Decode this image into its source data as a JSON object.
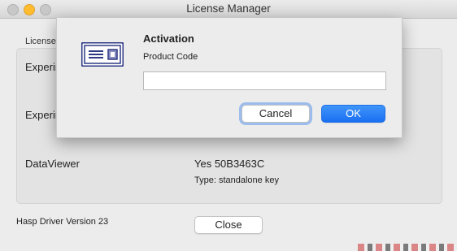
{
  "window": {
    "title": "License Manager"
  },
  "main": {
    "group_label": "Licenses",
    "rows": [
      {
        "label": "Experim",
        "value": "",
        "detail": ""
      },
      {
        "label": "Experim",
        "value": "",
        "detail": ""
      },
      {
        "label": "DataViewer",
        "value": "Yes 50B3463C",
        "detail": "Type: standalone key"
      }
    ],
    "driver_version": "Hasp Driver Version 23",
    "close_label": "Close"
  },
  "sheet": {
    "icon": "license-card-icon",
    "title": "Activation",
    "field_label": "Product Code",
    "field_value": "",
    "field_placeholder": "",
    "cancel_label": "Cancel",
    "ok_label": "OK"
  },
  "colors": {
    "accent": "#1a6ff2",
    "icon_navy": "#2e3a86",
    "focus_ring": "#5b96ec"
  }
}
